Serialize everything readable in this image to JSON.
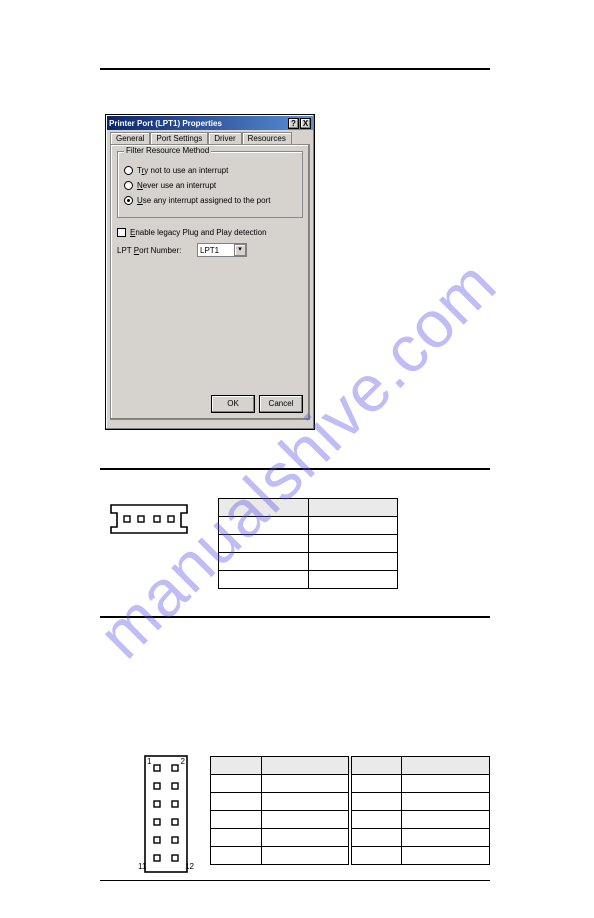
{
  "watermark": "manualshive.com",
  "dialog": {
    "title": "Printer Port (LPT1) Properties",
    "help_btn": "?",
    "close_btn": "X",
    "tabs": [
      "General",
      "Port Settings",
      "Driver",
      "Resources"
    ],
    "active_tab": 1,
    "group_legend": "Filter Resource Method",
    "radios": [
      {
        "label_pre": "T",
        "label_u": "r",
        "label_post": "y not to use an interrupt",
        "checked": false
      },
      {
        "label_pre": "",
        "label_u": "N",
        "label_post": "ever use an interrupt",
        "checked": false
      },
      {
        "label_pre": "",
        "label_u": "U",
        "label_post": "se any interrupt assigned to the port",
        "checked": true
      }
    ],
    "checkbox": {
      "label_pre": "",
      "label_u": "E",
      "label_post": "nable legacy Plug and Play detection",
      "checked": false
    },
    "combo_label_pre": "LPT ",
    "combo_label_u": "P",
    "combo_label_post": "ort Number:",
    "combo_value": "LPT1",
    "combo_arrow": "▾",
    "ok": "OK",
    "cancel": "Cancel"
  },
  "table1": {
    "headers": [
      "",
      ""
    ],
    "rows": [
      [
        "",
        ""
      ],
      [
        "",
        ""
      ],
      [
        "",
        ""
      ],
      [
        "",
        ""
      ]
    ]
  },
  "conn12_labels": {
    "tl": "1",
    "tr": "2",
    "bl": "11",
    "br": "12"
  },
  "table2": {
    "headers_left": [
      "",
      ""
    ],
    "headers_right": [
      "",
      ""
    ],
    "rows": [
      [
        [
          "",
          ""
        ],
        [
          "",
          ""
        ]
      ],
      [
        [
          "",
          ""
        ],
        [
          "",
          ""
        ]
      ],
      [
        [
          "",
          ""
        ],
        [
          "",
          ""
        ]
      ],
      [
        [
          "",
          ""
        ],
        [
          "",
          ""
        ]
      ],
      [
        [
          "",
          ""
        ],
        [
          "",
          ""
        ]
      ]
    ]
  }
}
